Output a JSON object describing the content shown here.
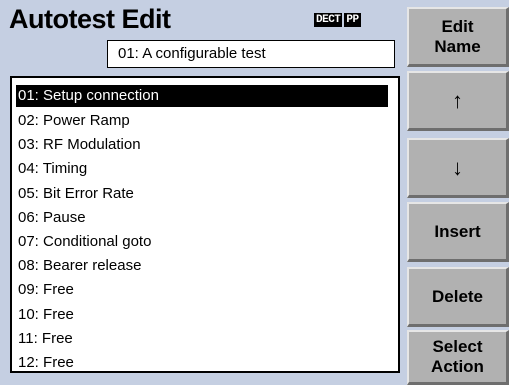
{
  "app": {
    "title": "Autotest Edit",
    "mode_badge": [
      "DECT",
      "PP"
    ]
  },
  "test_name": {
    "value": "01: A configurable test"
  },
  "steps": {
    "selected_index": 0,
    "items": [
      {
        "num": "01:",
        "label": "Setup connection"
      },
      {
        "num": "02:",
        "label": "Power Ramp"
      },
      {
        "num": "03:",
        "label": "RF Modulation"
      },
      {
        "num": "04:",
        "label": "Timing"
      },
      {
        "num": "05:",
        "label": "Bit Error Rate"
      },
      {
        "num": "06:",
        "label": "Pause"
      },
      {
        "num": "07:",
        "label": "Conditional goto"
      },
      {
        "num": "08:",
        "label": "Bearer release"
      },
      {
        "num": "09:",
        "label": "Free"
      },
      {
        "num": "10:",
        "label": "Free"
      },
      {
        "num": "11:",
        "label": "Free"
      },
      {
        "num": "12:",
        "label": "Free"
      }
    ]
  },
  "softkeys": {
    "edit_name": "Edit\nName",
    "up": "↑",
    "down": "↓",
    "insert": "Insert",
    "delete": "Delete",
    "select_action": "Select\nAction"
  },
  "icons": {
    "up": "up-arrow-icon",
    "down": "down-arrow-icon"
  },
  "colors": {
    "screen_background": "#c5cfe2",
    "softkey_background": "#b1b1b1",
    "selection_background": "#000000",
    "selection_text": "#ffffff"
  }
}
